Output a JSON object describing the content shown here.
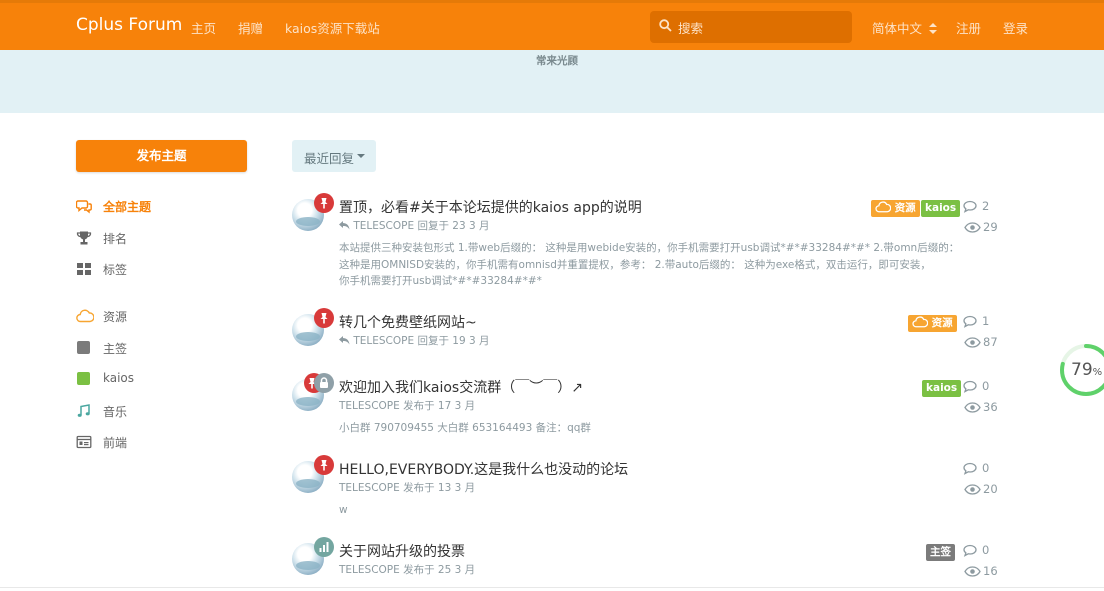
{
  "header": {
    "brand": "Cplus Forum",
    "nav": [
      "主页",
      "捐赠",
      "kaios资源下载站"
    ],
    "search_placeholder": "搜索",
    "language": "简体中文",
    "signup": "注册",
    "login": "登录"
  },
  "hero": {
    "text": "常来光顾"
  },
  "sidebar": {
    "start_button": "发布主题",
    "items": [
      {
        "label": "全部主题",
        "icon": "comments-icon",
        "active": true
      },
      {
        "label": "排名",
        "icon": "trophy-icon"
      },
      {
        "label": "标签",
        "icon": "tags-grid-icon"
      },
      {
        "label": "资源",
        "icon": "cloud-icon"
      },
      {
        "label": "主签",
        "icon": "tag-square-icon",
        "color": "#7b7b7b"
      },
      {
        "label": "kaios",
        "icon": "tag-square-icon",
        "color": "#7BC043"
      },
      {
        "label": "音乐",
        "icon": "music-icon"
      },
      {
        "label": "前端",
        "icon": "code-icon"
      }
    ]
  },
  "sort": {
    "label": "最近回复"
  },
  "colors": {
    "brand": "#F7820A",
    "hero": "#E2F1F5",
    "resource": "#F7A531",
    "kaios": "#7BC043",
    "sticky": "#7b7b7b",
    "pin": "#D83A3A",
    "lock": "#8FA0A8",
    "poll": "#73A6A0"
  },
  "discussions": [
    {
      "title": "置顶，必看#关于本论坛提供的kaios app的说明",
      "meta": "TELESCOPE 回复于 23 3 月",
      "excerpt": [
        "本站提供三种安装包形式 1.带web后缀的： 这种是用webide安装的，你手机需要打开usb调试*#*#33284#*#* 2.带omn后缀的：",
        "这种是用OMNISD安装的，你手机需有omnisd并重置提权，参考： 2.带auto后缀的： 这种为exe格式，双击运行，即可安装，",
        "你手机需要打开usb调试*#*#33284#*#*"
      ],
      "tags": [
        "资源",
        "kaios"
      ],
      "replies": "2",
      "views": "29"
    },
    {
      "title": "转几个免费壁纸网站~",
      "meta": "TELESCOPE 回复于 19 3 月",
      "excerpt": [],
      "tags": [
        "资源"
      ],
      "replies": "1",
      "views": "87"
    },
    {
      "title": "欢迎加入我们kaios交流群（￣︶￣）↗",
      "meta": "TELESCOPE 发布于 17 3 月",
      "excerpt": [
        "小白群 790709455 大白群 653164493 备注：qq群"
      ],
      "tags": [
        "kaios"
      ],
      "replies": "0",
      "views": "36"
    },
    {
      "title": "HELLO,EVERYBODY.这是我什么也没动的论坛",
      "meta": "TELESCOPE 发布于 13 3 月",
      "excerpt": [
        "w"
      ],
      "tags": [],
      "replies": "0",
      "views": "20"
    },
    {
      "title": "关于网站升级的投票",
      "meta": "TELESCOPE 发布于 25 3 月",
      "excerpt": [],
      "tags": [
        "主签"
      ],
      "replies": "0",
      "views": "16"
    }
  ],
  "progress": {
    "value": 79,
    "unit": "%"
  }
}
